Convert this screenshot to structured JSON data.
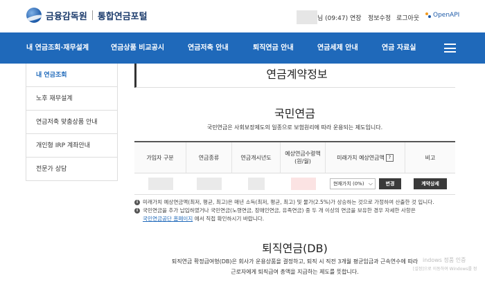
{
  "header": {
    "org_name": "금융감독원",
    "portal_name": "통합연금포털",
    "user_suffix": "님 (09:47)",
    "links": [
      "연장",
      "정보수정",
      "로그아웃"
    ],
    "openapi": "OpenAPI"
  },
  "gnb": {
    "items": [
      "내 연금조회·재무설계",
      "연금상품 비교공시",
      "연금저축 안내",
      "퇴직연금 안내",
      "연금세제 안내",
      "연금 자료실"
    ]
  },
  "lnb": {
    "items": [
      "내 연금조회",
      "노후 재무설계",
      "연금저축 맞춤상품 안내",
      "개인형 IRP 계좌안내",
      "전문가 상담"
    ]
  },
  "page": {
    "title": "연금계약정보"
  },
  "national": {
    "title": "국민연금",
    "desc": "국민연금은 사회보장제도의 일종으로 보험원리에 따라 운용되는 제도입니다.",
    "headers": [
      "가입자 구분",
      "연금종류",
      "연금개시년도",
      "예상연금수령액\n(원/월)",
      "미래가치 예상연금액",
      "비고"
    ],
    "help": "?",
    "select_value": "현재가치 (0%)",
    "change_button": "변경",
    "detail_button": "계약상세",
    "notes": [
      "미래가치 예상연금액(최저, 평균, 최고)은 매년 소득(최저, 평균, 최고) 및 물가(2.5%)가 상승하는 것으로 가정하여 산출한 것 입니다.",
      "국민연금을 추가 납입하였거나 국민연금(노령연금, 장애인연금, 유족연금) 중 두 개 이상의 연금을 보유한 경우 자세한 사항은"
    ],
    "note_link": "국민연금공단 홈페이지",
    "note_link_suffix": "에서 직접 확인하시기 바랍니다."
  },
  "retirement": {
    "title": "퇴직연금(DB)",
    "desc1": "퇴직연금 확정급여형(DB)은 회사가 운용상품을 결정하고, 퇴직 시 직전 3개월 평균임금과 근속연수에 따라",
    "desc2": "근로자에게 퇴직급여 총액을 지급하는 제도를 뜻합니다."
  },
  "watermark": {
    "line1": "indows 정품 인증",
    "line2": "[설정]으로 이동하여 Windows를 정"
  }
}
